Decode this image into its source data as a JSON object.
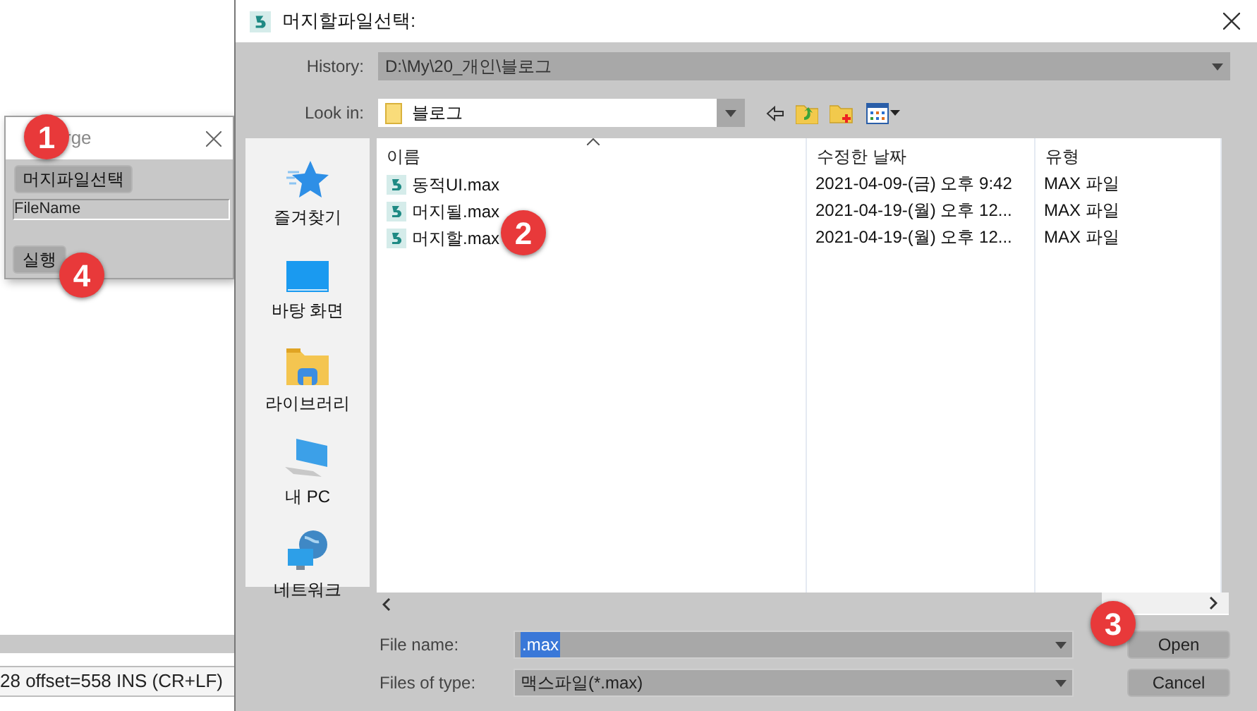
{
  "background_app": {
    "status_bar": "28 offset=558 INS (CR+LF)"
  },
  "merge_dialog": {
    "title": "rge",
    "select_button": "머지파일선택",
    "file_field": {
      "value": "FileName"
    },
    "run_button": "실행"
  },
  "file_dialog": {
    "title": "머지할파일선택:",
    "history": {
      "label": "History:",
      "value": "D:\\My\\20_개인\\블로그"
    },
    "look_in": {
      "label": "Look in:",
      "value": "블로그"
    },
    "places": [
      {
        "kind": "favorites",
        "label": "즐겨찾기"
      },
      {
        "kind": "desktop",
        "label": "바탕 화면"
      },
      {
        "kind": "library",
        "label": "라이브러리"
      },
      {
        "kind": "pc",
        "label": "내 PC"
      },
      {
        "kind": "network",
        "label": "네트워크"
      }
    ],
    "columns": [
      "이름",
      "수정한 날짜",
      "유형"
    ],
    "files": [
      {
        "name": "동적UI.max",
        "modified": "2021-04-09-(금) 오후 9:42",
        "type": "MAX 파일"
      },
      {
        "name": "머지될.max",
        "modified": "2021-04-19-(월) 오후 12...",
        "type": "MAX 파일"
      },
      {
        "name": "머지할.max",
        "modified": "2021-04-19-(월) 오후 12...",
        "type": "MAX 파일"
      }
    ],
    "file_name": {
      "label": "File name:",
      "value": ".max"
    },
    "file_type": {
      "label": "Files of type:",
      "value": "맥스파일(*.max)"
    },
    "buttons": [
      "Open",
      "Cancel"
    ]
  },
  "callouts": [
    "1",
    "2",
    "3",
    "4"
  ]
}
